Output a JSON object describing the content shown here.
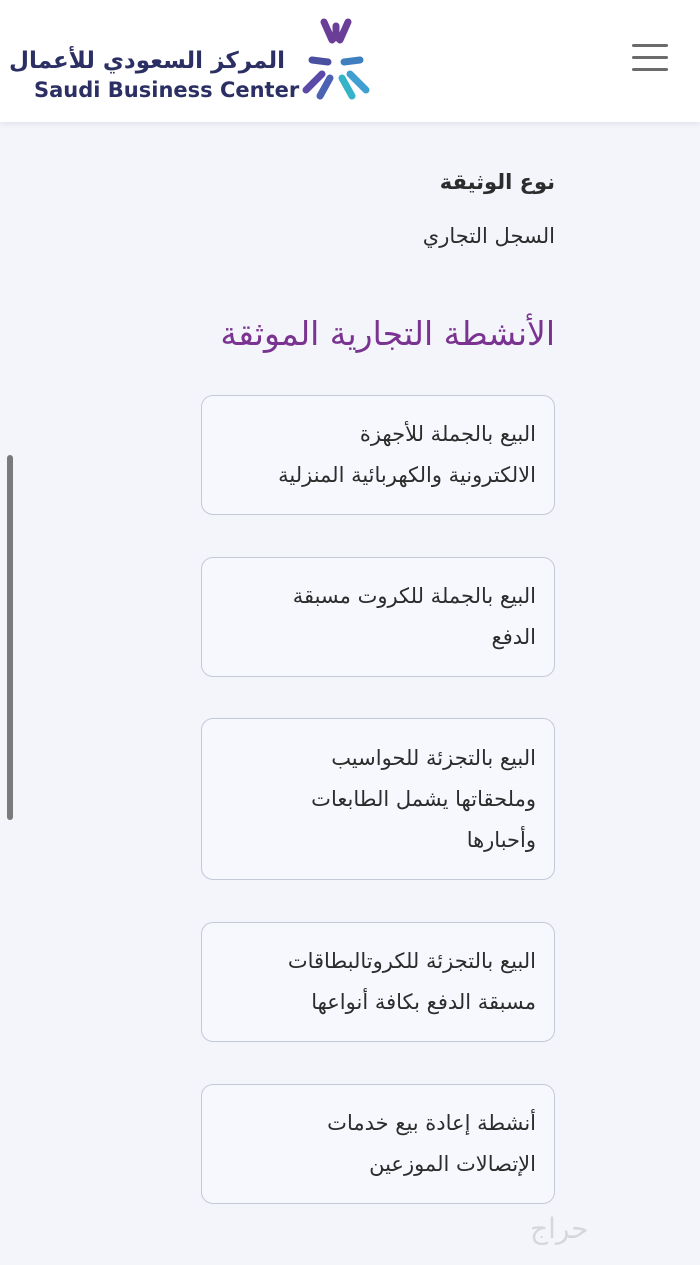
{
  "header": {
    "logo_arabic": "المركز السعودي للأعمال",
    "logo_english": "Saudi Business Center",
    "menu_icon": "hamburger-menu-icon",
    "logo_icon": "star-arrows-logo-icon"
  },
  "document": {
    "type_label": "نوع الوثيقة",
    "type_value": "السجل التجاري"
  },
  "activities": {
    "title": "الأنشطة التجارية الموثقة",
    "items": [
      {
        "lines": [
          "البيع بالجملة للأجهزة",
          "الالكترونية والكهربائية المنزلية"
        ]
      },
      {
        "lines": [
          "البيع بالجملة للكروت مسبقة",
          "الدفع"
        ]
      },
      {
        "lines": [
          "البيع بالتجزئة للحواسيب",
          "وملحقاتها يشمل الطابعات",
          "وأحبارها"
        ]
      },
      {
        "lines": [
          "البيع بالتجزئة للكروتالبطاقات",
          "مسبقة الدفع بكافة أنواعها"
        ]
      },
      {
        "lines": [
          "أنشطة إعادة بيع خدمات",
          "الإتصالات الموزعين"
        ]
      }
    ]
  },
  "watermark": "حراج",
  "colors": {
    "brand_navy": "#2b2f63",
    "accent_purple": "#7a3390",
    "logo_purple": "#6a3d97",
    "logo_blue": "#3f7fc0",
    "logo_cyan": "#35b3c9",
    "card_border": "#c3c9d8",
    "background": "#f3f5fb"
  }
}
